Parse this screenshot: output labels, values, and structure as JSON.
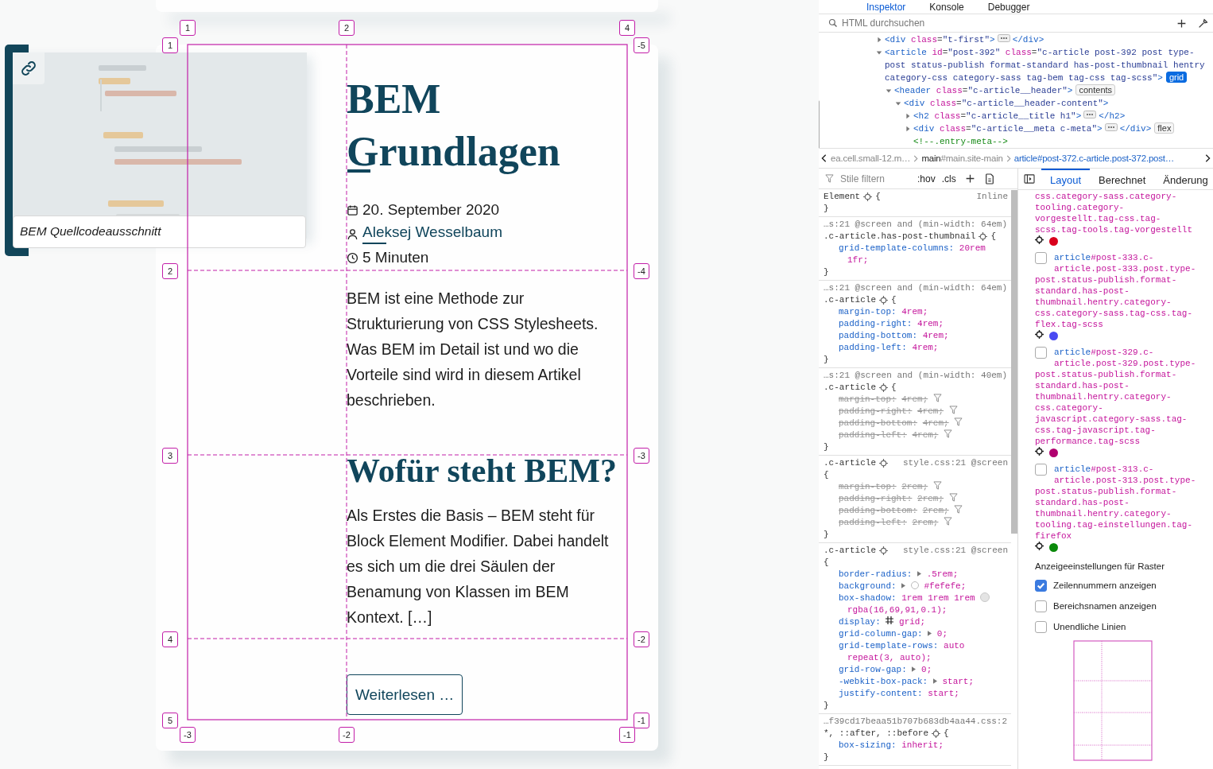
{
  "article": {
    "thumbnail": {
      "kind": "picture",
      "caption": "BEM Quellcodeausschnitt"
    },
    "title": "BEM Grundlagen",
    "date": "20. September 2020",
    "author": "Aleksej Wesselbaum",
    "reading_time": "5 Minuten",
    "excerpt": "BEM ist eine Methode zur Strukturierung von CSS Stylesheets. Was BEM im Detail ist und wo die Vorteile sind wird in diesem Artikel beschrieben.",
    "section_heading": "Wofür steht BEM?",
    "section_text": "Als Erstes die Basis – BEM steht für Block Element Modifier. Dabei handelt es sich um die drei Säulen der Benamung von Klassen im BEM Kontext. […]",
    "read_more": "Weiterlesen …"
  },
  "grid_overlay": {
    "top_labels": [
      "1",
      "2",
      "4"
    ],
    "bottom_labels": [
      "-3",
      "-2",
      "-1"
    ],
    "left_labels": [
      "1",
      "2",
      "3",
      "4",
      "5"
    ],
    "right_labels": [
      "-5",
      "-4",
      "-3",
      "-2",
      "-1"
    ]
  },
  "devtools": {
    "tabs": [
      {
        "label": "Inspektor",
        "selected": true
      },
      {
        "label": "Konsole",
        "selected": false
      },
      {
        "label": "Debugger",
        "selected": false
      }
    ],
    "search": {
      "placeholder": "HTML durchsuchen"
    },
    "markup": [
      {
        "kind": "element",
        "expanded": false,
        "tokens": [
          {
            "kind": "tag",
            "t": "<div"
          },
          {
            "kind": "attr",
            "t": " class"
          },
          {
            "kind": "punct",
            "t": "="
          },
          {
            "kind": "val",
            "t": "\"t-first\""
          },
          {
            "kind": "tag",
            "t": ">"
          },
          {
            "kind": "more"
          },
          {
            "kind": "tag",
            "t": "</div>"
          }
        ]
      },
      {
        "kind": "element",
        "expanded": true,
        "tokens": [
          {
            "kind": "tag",
            "t": "<article"
          },
          {
            "kind": "attr",
            "t": " id"
          },
          {
            "kind": "punct",
            "t": "="
          },
          {
            "kind": "val",
            "t": "\"post-392\""
          },
          {
            "kind": "attr",
            "t": " class"
          },
          {
            "kind": "punct",
            "t": "="
          },
          {
            "kind": "val",
            "t": "\"c-article post-392 post type-post status-publish format-standard has-post-thumbnail hentry category-css category-sass tag-bem tag-css tag-scss\""
          },
          {
            "kind": "tag",
            "t": ">"
          },
          {
            "kind": "badge",
            "t": "grid",
            "active": true
          }
        ],
        "children": [
          {
            "kind": "element",
            "expanded": true,
            "tokens": [
              {
                "kind": "tag",
                "t": "<header"
              },
              {
                "kind": "attr",
                "t": " class"
              },
              {
                "kind": "punct",
                "t": "="
              },
              {
                "kind": "val",
                "t": "\"c-article__header\""
              },
              {
                "kind": "tag",
                "t": ">"
              },
              {
                "kind": "badge",
                "t": "contents",
                "active": false
              }
            ],
            "children": [
              {
                "kind": "element",
                "expanded": true,
                "tokens": [
                  {
                    "kind": "tag",
                    "t": "<div"
                  },
                  {
                    "kind": "attr",
                    "t": " class"
                  },
                  {
                    "kind": "punct",
                    "t": "="
                  },
                  {
                    "kind": "val",
                    "t": "\"c-article__header-content\""
                  },
                  {
                    "kind": "tag",
                    "t": ">"
                  }
                ],
                "children": [
                  {
                    "kind": "element",
                    "expanded": false,
                    "tokens": [
                      {
                        "kind": "tag",
                        "t": "<h2"
                      },
                      {
                        "kind": "attr",
                        "t": " class"
                      },
                      {
                        "kind": "punct",
                        "t": "="
                      },
                      {
                        "kind": "val",
                        "t": "\"c-article__title h1\""
                      },
                      {
                        "kind": "tag",
                        "t": ">"
                      },
                      {
                        "kind": "more"
                      },
                      {
                        "kind": "tag",
                        "t": "</h2>"
                      }
                    ]
                  },
                  {
                    "kind": "element",
                    "expanded": false,
                    "tokens": [
                      {
                        "kind": "tag",
                        "t": "<div"
                      },
                      {
                        "kind": "attr",
                        "t": " class"
                      },
                      {
                        "kind": "punct",
                        "t": "="
                      },
                      {
                        "kind": "val",
                        "t": "\"c-article__meta c-meta\""
                      },
                      {
                        "kind": "tag",
                        "t": ">"
                      },
                      {
                        "kind": "more"
                      },
                      {
                        "kind": "tag",
                        "t": "</div>"
                      },
                      {
                        "kind": "badge",
                        "t": "flex",
                        "active": false
                      }
                    ]
                  },
                  {
                    "kind": "comment",
                    "tokens": [
                      {
                        "kind": "comment",
                        "t": "<!--.entry-meta-->"
                      }
                    ]
                  }
                ]
              }
            ]
          }
        ]
      }
    ],
    "breadcrumbs": [
      {
        "rest": "ea.cell.small-12.m…",
        "selected": false
      },
      {
        "tag": "main",
        "rest": "#main.site-main",
        "selected": false
      },
      {
        "tag": "article",
        "rest": "#post-372.c-article.post-372.post…",
        "selected": true
      }
    ],
    "rules_toolbar": {
      "placeholder": "Stile filtern",
      "buttons": [
        ":hov",
        ".cls"
      ]
    },
    "rules": [
      {
        "source": "Inline",
        "kind": "source_right",
        "selector": "Element",
        "open": "{",
        "close": "}"
      },
      {
        "source": "…s:21 @screen and (min-width: 64em)",
        "kind": "source_above",
        "selector": ".c-article.has-post-thumbnail",
        "open": "{",
        "close": "}",
        "declarations": [
          {
            "prop": "grid-template-columns:",
            "value": "20rem 1fr;",
            "overridden": false
          }
        ]
      },
      {
        "source": "…s:21 @screen and (min-width: 64em)",
        "kind": "source_above",
        "selector": ".c-article",
        "open": "{",
        "close": "}",
        "declarations": [
          {
            "prop": "margin-top:",
            "value": "4rem;",
            "overridden": false
          },
          {
            "prop": "padding-right:",
            "value": "4rem;",
            "overridden": false
          },
          {
            "prop": "padding-bottom:",
            "value": "4rem;",
            "overridden": false
          },
          {
            "prop": "padding-left:",
            "value": "4rem;",
            "overridden": false
          }
        ]
      },
      {
        "source": "…s:21 @screen and (min-width: 40em)",
        "kind": "source_above",
        "selector": ".c-article",
        "open": "{",
        "close": "}",
        "declarations": [
          {
            "prop": "margin-top:",
            "value": "4rem;",
            "overridden": true
          },
          {
            "prop": "padding-right:",
            "value": "4rem;",
            "overridden": true
          },
          {
            "prop": "padding-bottom:",
            "value": "4rem;",
            "overridden": true
          },
          {
            "prop": "padding-left:",
            "value": "4rem;",
            "overridden": true
          }
        ]
      },
      {
        "source": "style.css:21 @screen",
        "kind": "source_beside",
        "selector": ".c-article",
        "open": "{",
        "close": "}",
        "declarations": [
          {
            "prop": "margin-top:",
            "value": "2rem;",
            "overridden": true
          },
          {
            "prop": "padding-right:",
            "value": "2rem;",
            "overridden": true
          },
          {
            "prop": "padding-bottom:",
            "value": "2rem;",
            "overridden": true
          },
          {
            "prop": "padding-left:",
            "value": "2rem;",
            "overridden": true
          }
        ]
      },
      {
        "source": "style.css:21 @screen",
        "kind": "source_beside",
        "selector": ".c-article",
        "open": "{",
        "close": "}",
        "declarations": [
          {
            "prop": "border-radius:",
            "kind": "expander",
            "value": ".5rem;",
            "overridden": false
          },
          {
            "prop": "background:",
            "kind": "expander_swatch",
            "value": "#fefefe;",
            "overridden": false
          },
          {
            "prop": "box-shadow:",
            "value": "1rem 1rem 1rem",
            "after_swatch": "rgba(16,69,91,0.1);",
            "overridden": false
          },
          {
            "prop": "display:",
            "kind": "grid",
            "value": "grid;",
            "overridden": false
          },
          {
            "prop": "grid-column-gap:",
            "kind": "expander",
            "value": "0;",
            "overridden": false
          },
          {
            "prop": "grid-template-rows:",
            "value": "auto repeat(3, auto);",
            "overridden": false
          },
          {
            "prop": "grid-row-gap:",
            "kind": "expander",
            "value": "0;",
            "overridden": false
          },
          {
            "prop": "-webkit-box-pack:",
            "kind": "expander",
            "value": "start;",
            "overridden": false
          },
          {
            "prop": "justify-content:",
            "value": "start;",
            "overridden": false
          }
        ]
      },
      {
        "source": "…f39cd17beaa51b707b683db4aa44.css:2",
        "kind": "source_above",
        "selector": "*, ::after, ::before",
        "open": "{",
        "close": "}",
        "declarations": [
          {
            "prop": "box-sizing:",
            "value": "inherit;",
            "overridden": false
          }
        ]
      }
    ],
    "sidebar_tabs": [
      {
        "label": "Layout",
        "selected": true
      },
      {
        "label": "Berechnet",
        "selected": false
      },
      {
        "label": "Änderung",
        "selected": false
      }
    ],
    "grid_list_cut_item": {
      "selector": "css.category-sass.category-tooling.category-vorgestellt.tag-css.tag-scss.tag-tools.tag-vorgestellt",
      "color": "#d9001c"
    },
    "grid_list": [
      {
        "checked": false,
        "tag": "article",
        "selector": "#post-333.c-article.post-333.post.type-post.status-publish.format-standard.has-post-thumbnail.hentry.category-css.category-sass.tag-css.tag-flex.tag-scss",
        "color": "#4a4af2"
      },
      {
        "checked": false,
        "tag": "article",
        "selector": "#post-329.c-article.post-329.post.type-post.status-publish.format-standard.has-post-thumbnail.hentry.category-css.category-javascript.category-sass.tag-css.tag-javascript.tag-performance.tag-scss",
        "color": "#b0006f"
      },
      {
        "checked": false,
        "tag": "article",
        "selector": "#post-313.c-article.post-313.post.type-post.status-publish.format-standard.has-post-thumbnail.hentry.category-tooling.tag-einstellungen.tag-firefox",
        "color": "#0b8a0b"
      }
    ],
    "display_settings": {
      "title": "Anzeigeeinstellungen für Raster",
      "options": [
        {
          "label": "Zeilennummern anzeigen",
          "checked": true
        },
        {
          "label": "Bereichsnamen anzeigen",
          "checked": false
        },
        {
          "label": "Unendliche Linien",
          "checked": false
        }
      ]
    }
  }
}
